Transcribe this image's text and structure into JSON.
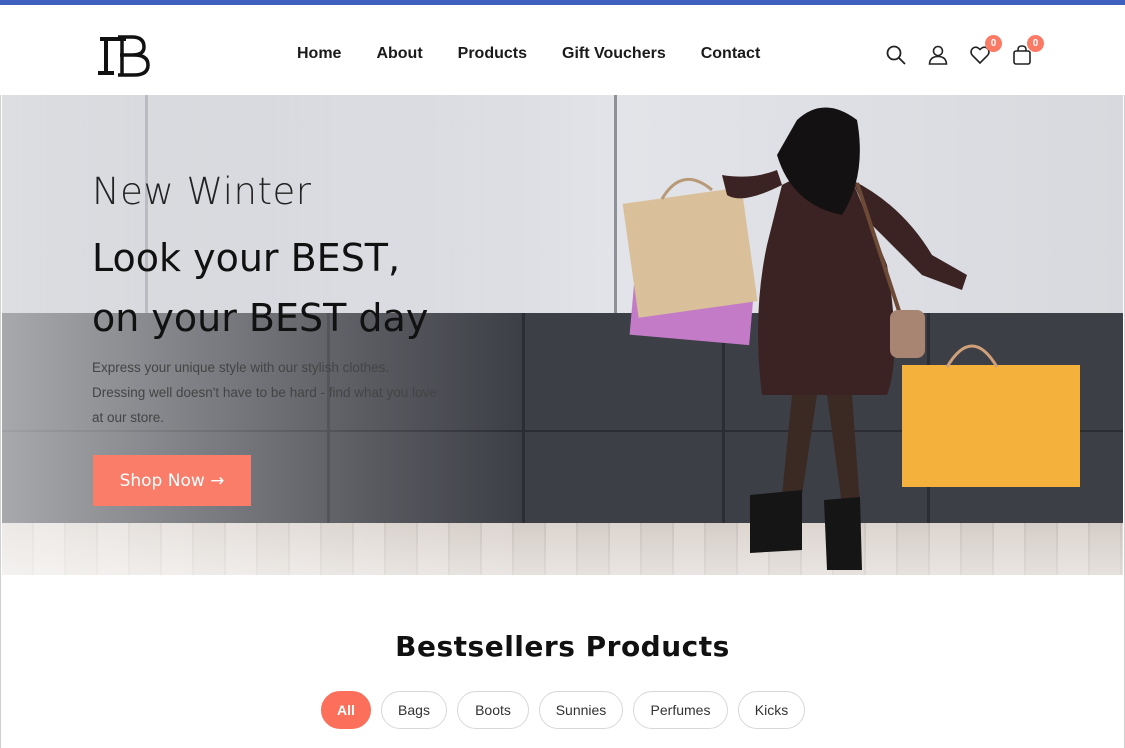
{
  "nav": {
    "items": [
      "Home",
      "About",
      "Products",
      "Gift Vouchers",
      "Contact"
    ]
  },
  "header_icons": {
    "wishlist_count": "0",
    "cart_count": "0"
  },
  "hero": {
    "subtitle": "New Winter",
    "title_line1": "Look your BEST,",
    "title_line2": "on your BEST day",
    "description_line1": "Express your unique style with our stylish clothes.",
    "description_line2": "Dressing well doesn't have to be hard - find what you love",
    "description_line3": "at our store.",
    "cta": "Shop Now →"
  },
  "bestsellers": {
    "title": "Bestsellers Products",
    "tabs": [
      "All",
      "Bags",
      "Boots",
      "Sunnies",
      "Perfumes",
      "Kicks"
    ]
  },
  "colors": {
    "accent": "#fb6f5b",
    "topbar": "#3f5fbf"
  }
}
